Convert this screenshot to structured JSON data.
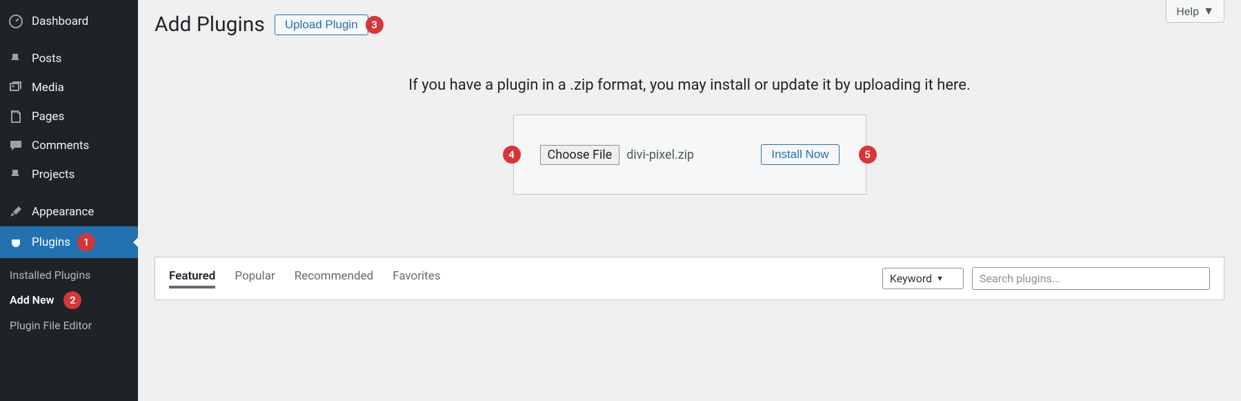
{
  "sidebar": {
    "items": [
      {
        "label": "Dashboard",
        "icon": "dashboard"
      },
      {
        "label": "Posts",
        "icon": "pin"
      },
      {
        "label": "Media",
        "icon": "media"
      },
      {
        "label": "Pages",
        "icon": "pages"
      },
      {
        "label": "Comments",
        "icon": "comment"
      },
      {
        "label": "Projects",
        "icon": "pin"
      },
      {
        "label": "Appearance",
        "icon": "brush"
      },
      {
        "label": "Plugins",
        "icon": "plug"
      }
    ],
    "submenu": [
      {
        "label": "Installed Plugins"
      },
      {
        "label": "Add New"
      },
      {
        "label": "Plugin File Editor"
      }
    ]
  },
  "help_label": "Help",
  "annotations": {
    "1": "1",
    "2": "2",
    "3": "3",
    "4": "4",
    "5": "5"
  },
  "page": {
    "title": "Add Plugins",
    "upload_button": "Upload Plugin",
    "instructions": "If you have a plugin in a .zip format, you may install or update it by uploading it here.",
    "choose_file": "Choose File",
    "filename": "divi-pixel.zip",
    "install_now": "Install Now"
  },
  "filter": {
    "tabs": [
      "Featured",
      "Popular",
      "Recommended",
      "Favorites"
    ],
    "keyword_label": "Keyword",
    "search_placeholder": "Search plugins..."
  }
}
